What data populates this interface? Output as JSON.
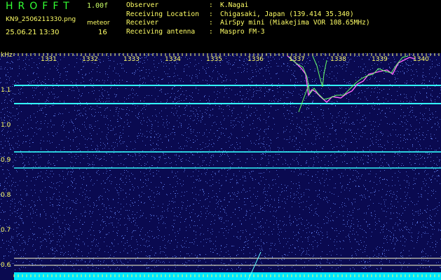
{
  "header": {
    "app_title": "HROFFT",
    "version": "1.00f",
    "filename": "KN9_2506211330.png",
    "timestamp": "25.06.21 13:30",
    "meteor_label": "meteor",
    "meteor_count": "16"
  },
  "info": [
    {
      "key": "Observer",
      "value": "K.Nagai"
    },
    {
      "key": "Receiving Location",
      "value": "Chigasaki, Japan (139.414 35.340)"
    },
    {
      "key": "Receiver",
      "value": "AirSpy mini (Miakejima VOR 108.65MHz)"
    },
    {
      "key": "Receiving antenna",
      "value": "Maspro FM-3"
    }
  ],
  "plot": {
    "y_unit": "kHz",
    "x_ticks": [
      "1331",
      "1332",
      "1333",
      "1334",
      "1335",
      "1336",
      "1337",
      "1338",
      "1339",
      "1340"
    ],
    "y_ticks": [
      "1.1",
      "1.0",
      "0.9",
      "0.8",
      "0.7",
      "0.6"
    ],
    "colors": {
      "background": "#0a0a50",
      "noise": "#6a8cff",
      "cyan_line": "#33ffff",
      "baseline": "#00e5ff",
      "tick": "#ffff66"
    }
  }
}
